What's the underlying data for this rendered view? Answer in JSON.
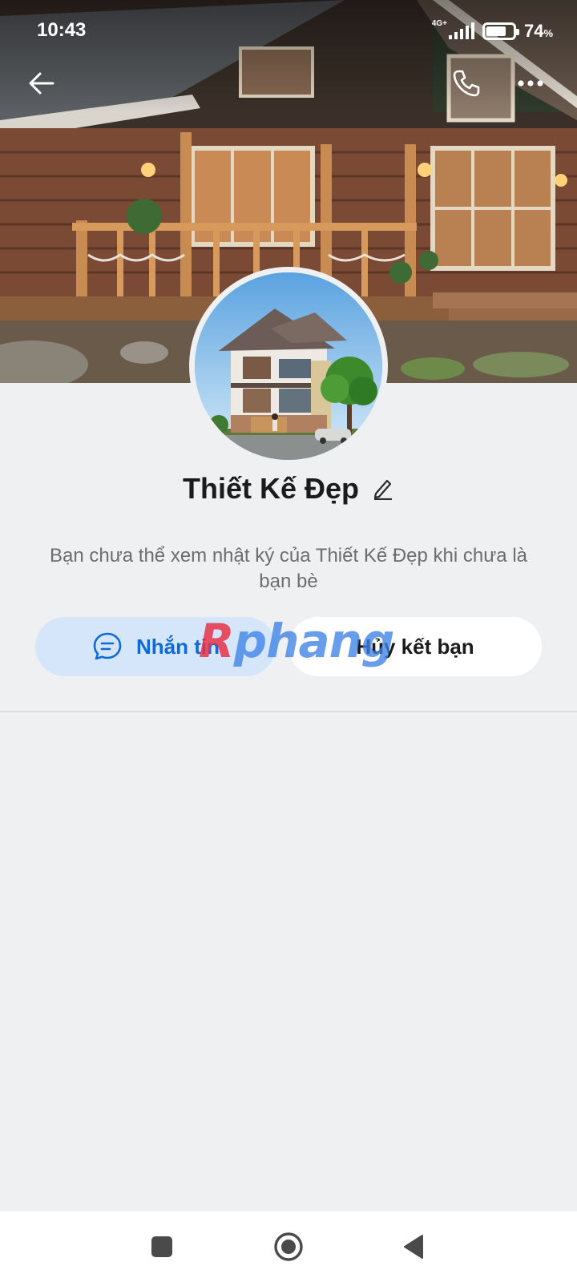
{
  "status_bar": {
    "time": "10:43",
    "network": "4G+",
    "battery_percent": "74",
    "battery_symbol": "%",
    "battery_level": 0.74
  },
  "top_nav": {
    "back_icon": "arrow-left-icon",
    "call_icon": "phone-icon",
    "more_icon": "more-horizontal-icon"
  },
  "profile": {
    "name": "Thiết Kế Đẹp",
    "edit_icon": "pencil-icon",
    "info_text": "Bạn chưa thể xem nhật ký của Thiết Kế Đẹp khi chưa là bạn bè"
  },
  "actions": {
    "message_label": "Nhắn tin",
    "message_icon": "chat-bubble-icon",
    "unfriend_label": "Hủy kết bạn"
  },
  "watermark": {
    "first": "R",
    "rest": "phang"
  },
  "system_nav": {
    "recent_icon": "square-icon",
    "home_icon": "circle-icon",
    "back_icon": "triangle-back-icon"
  },
  "colors": {
    "accent": "#0d6ad8",
    "message_button_bg": "#d5e6fb",
    "page_bg": "#eef0f2"
  }
}
